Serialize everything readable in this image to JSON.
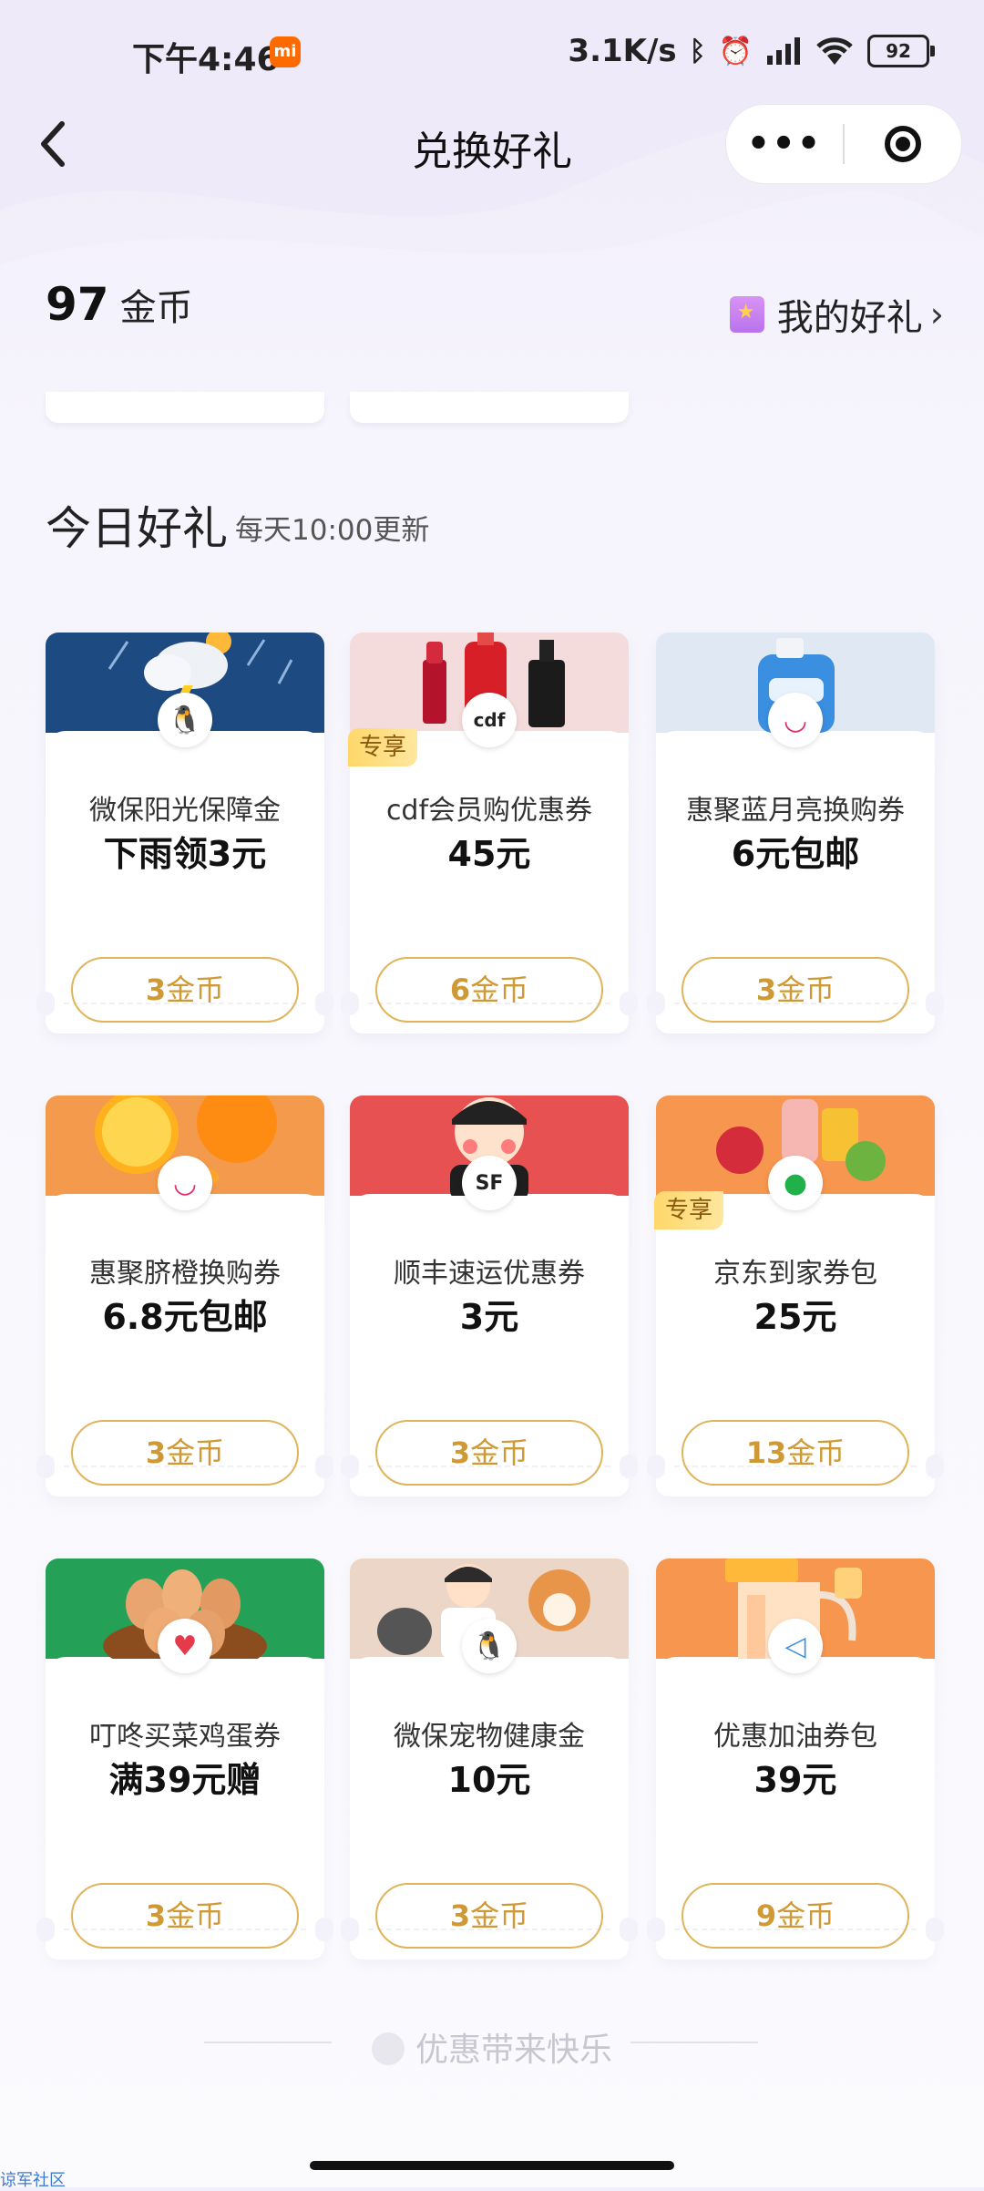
{
  "status_bar": {
    "time": "下午4:46",
    "mi_badge": "mi",
    "speed": "3.1K/s",
    "battery": "92",
    "icons": [
      "bluetooth-icon",
      "alarm-icon",
      "signal-icon",
      "wifi-icon",
      "battery-icon"
    ]
  },
  "nav": {
    "title": "兑换好礼",
    "more_glyph": "•••"
  },
  "coins": {
    "amount": "97",
    "unit": "金币"
  },
  "my_gifts": {
    "label": "我的好礼"
  },
  "section": {
    "title": "今日好礼",
    "subtitle": "每天10:00更新"
  },
  "cards": [
    {
      "brand": "微保阳光保障金",
      "value": "下雨领3元",
      "cost": "3",
      "coin_label": "金币",
      "exclusive": "",
      "top_color": "#1d4a80",
      "logo": "penguin-icon"
    },
    {
      "brand": "cdf会员购优惠券",
      "value": "45元",
      "cost": "6",
      "coin_label": "金币",
      "exclusive": "专享",
      "top_color": "#f5dcdc",
      "logo": "cdf-logo"
    },
    {
      "brand": "惠聚蓝月亮换购券",
      "value": "6元包邮",
      "cost": "3",
      "coin_label": "金币",
      "exclusive": "",
      "top_color": "#e0e8f3",
      "logo": "huiju-icon"
    },
    {
      "brand": "惠聚脐橙换购券",
      "value": "6.8元包邮",
      "cost": "3",
      "coin_label": "金币",
      "exclusive": "",
      "top_color": "#f39a4c",
      "logo": "huiju-icon"
    },
    {
      "brand": "顺丰速运优惠券",
      "value": "3元",
      "cost": "3",
      "coin_label": "金币",
      "exclusive": "",
      "top_color": "#e85151",
      "logo": "sf-icon"
    },
    {
      "brand": "京东到家券包",
      "value": "25元",
      "cost": "13",
      "coin_label": "金币",
      "exclusive": "专享",
      "top_color": "#f7964f",
      "logo": "jd-dog-icon"
    },
    {
      "brand": "叮咚买菜鸡蛋券",
      "value": "满39元赠",
      "cost": "3",
      "coin_label": "金币",
      "exclusive": "",
      "top_color": "#25a157",
      "logo": "dingdong-icon"
    },
    {
      "brand": "微保宠物健康金",
      "value": "10元",
      "cost": "3",
      "coin_label": "金币",
      "exclusive": "",
      "top_color": "#ecd6c8",
      "logo": "penguin-icon"
    },
    {
      "brand": "优惠加油券包",
      "value": "39元",
      "cost": "9",
      "coin_label": "金币",
      "exclusive": "",
      "top_color": "#f7964f",
      "logo": "fuel-icon"
    }
  ],
  "footer": {
    "text": "优惠带来快乐",
    "watermark": "谅军社区"
  }
}
